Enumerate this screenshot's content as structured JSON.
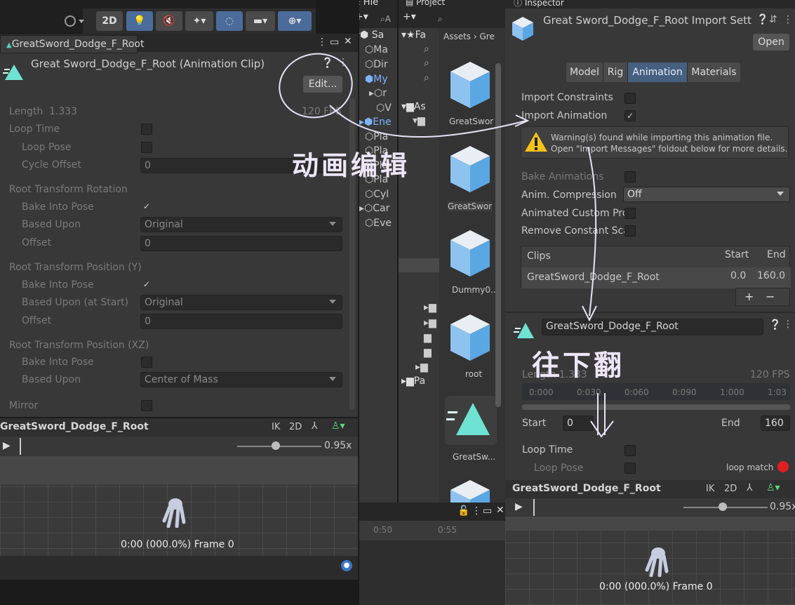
{
  "toolbar": {
    "btn_2d": "2D"
  },
  "hierarchy": {
    "tab": "Hie",
    "search": "A",
    "items": [
      "Sa",
      "Ma",
      "Dir",
      "My",
      "r",
      "V",
      "Ene",
      "Pla",
      "Pla",
      "Pla",
      "Pla",
      "Cyl",
      "Car",
      "Eve"
    ]
  },
  "project": {
    "tab": "Project",
    "breadcrumb_root": "Assets",
    "breadcrumb_next": "Gre",
    "favorites": "Fa",
    "assets_folder": "As",
    "pa_folder": "Pa",
    "assets": [
      "GreatSwor",
      "GreatSwor",
      "Dummy0..",
      "root",
      "GreatSw..."
    ]
  },
  "clip_panel": {
    "tab": "GreatSword_Dodge_F_Root",
    "title": "Great Sword_Dodge_F_Root (Animation Clip)",
    "edit": "Edit...",
    "fps": "120 FPS",
    "length_label": "Length",
    "length_value": "1.333",
    "loop_time": "Loop Time",
    "loop_pose": "Loop Pose",
    "cycle_offset": "Cycle Offset",
    "cycle_offset_value": "0",
    "rot_header": "Root Transform Rotation",
    "bake_into_pose": "Bake Into Pose",
    "based_upon": "Based Upon",
    "based_upon_value": "Original",
    "offset": "Offset",
    "offset_value": "0",
    "posy_header": "Root Transform Position (Y)",
    "based_upon_start": "Based Upon (at Start)",
    "based_upon_start_value": "Original",
    "offset2_value": "0",
    "posxz_header": "Root Transform Position (XZ)",
    "based_upon_xz_value": "Center of Mass",
    "mirror": "Mirror",
    "preview_name": "GreatSword_Dodge_F_Root",
    "ik": "IK",
    "twod": "2D",
    "speed": "0.95x",
    "frame": "0:00 (000.0%) Frame 0"
  },
  "timeline": {
    "t1": "0:50",
    "t2": "0:55"
  },
  "inspector": {
    "tab": "Inspector",
    "title": "Great Sword_Dodge_F_Root Import Sett",
    "open": "Open",
    "tabs": [
      "Model",
      "Rig",
      "Animation",
      "Materials"
    ],
    "import_constraints": "Import Constraints",
    "import_animation": "Import Animation",
    "warning_line1": "Warning(s) found while importing this animation file.",
    "warning_line2": "Open \"Import Messages\" foldout below for more details.",
    "bake_animations": "Bake Animations",
    "anim_compression": "Anim. Compression",
    "anim_compression_value": "Off",
    "animated_custom": "Animated Custom Pro",
    "remove_constant": "Remove Constant Sca",
    "clips_header": "Clips",
    "start_header": "Start",
    "end_header": "End",
    "clip_name": "GreatSword_Dodge_F_Root",
    "clip_start": "0.0",
    "clip_end": "160.0",
    "plus": "+",
    "minus": "−",
    "clip_field": "GreatSword_Dodge_F_Root",
    "length": "Length",
    "length_value": "1.333",
    "fps": "120 FPS",
    "ticks": [
      "0:000",
      "0:030",
      "0:060",
      "0:090",
      "1:000",
      "1:03"
    ],
    "start_label": "Start",
    "start_value": "0",
    "end_label": "End",
    "end_value": "160",
    "loop_time": "Loop Time",
    "loop_pose": "Loop Pose",
    "loop_match": "loop match",
    "preview_name": "GreatSword_Dodge_F_Root",
    "ik": "IK",
    "twod": "2D",
    "speed": "0.95x",
    "frame": "0:00 (000.0%) Frame 0"
  },
  "annotations": {
    "note1": "动画编辑",
    "note2": "往下翻"
  }
}
